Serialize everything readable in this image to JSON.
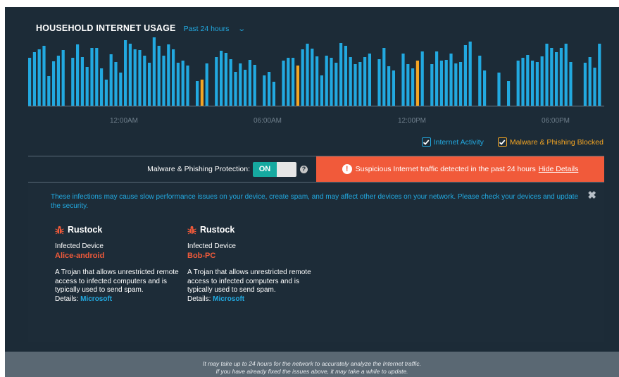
{
  "header": {
    "title": "HOUSEHOLD INTERNET USAGE",
    "range_label": "Past 24 hours"
  },
  "colors": {
    "activity": "#22a9e0",
    "malware": "#f5a623",
    "alert_bg": "#f15a3a",
    "toggle_on": "#16a9a0",
    "panel_bg": "#1c2b37"
  },
  "chart_data": {
    "type": "bar",
    "xlabel": "",
    "ylabel": "",
    "x_tick_labels": [
      "12:00AM",
      "06:00AM",
      "12:00PM",
      "06:00PM"
    ],
    "series": [
      {
        "name": "Internet Activity",
        "values": [
          68,
          76,
          80,
          85,
          42,
          63,
          71,
          79,
          0,
          68,
          87,
          69,
          55,
          82,
          82,
          53,
          37,
          73,
          62,
          47,
          93,
          88,
          80,
          79,
          71,
          61,
          97,
          85,
          71,
          87,
          80,
          61,
          64,
          57,
          0,
          35,
          0,
          60,
          0,
          69,
          78,
          75,
          66,
          48,
          60,
          51,
          65,
          58,
          0,
          43,
          48,
          34,
          0,
          64,
          68,
          68,
          0,
          80,
          88,
          81,
          70,
          43,
          71,
          68,
          61,
          89,
          85,
          69,
          59,
          62,
          69,
          74,
          0,
          66,
          82,
          56,
          50,
          0,
          74,
          59,
          53,
          0,
          77,
          0,
          59,
          77,
          64,
          65,
          74,
          60,
          62,
          86,
          91,
          0,
          71,
          50,
          0,
          0,
          47,
          0,
          35,
          0,
          64,
          68,
          72,
          64,
          62,
          70,
          88,
          82,
          76,
          82,
          88,
          62,
          0,
          0,
          61,
          69,
          54,
          88
        ]
      },
      {
        "name": "Malware & Phishing Blocked",
        "values": [
          0,
          0,
          0,
          0,
          0,
          0,
          0,
          0,
          0,
          0,
          0,
          0,
          0,
          0,
          0,
          0,
          0,
          0,
          0,
          0,
          0,
          0,
          0,
          0,
          0,
          0,
          0,
          0,
          0,
          0,
          0,
          0,
          0,
          0,
          0,
          0,
          37,
          0,
          0,
          0,
          0,
          0,
          0,
          0,
          0,
          0,
          0,
          0,
          0,
          0,
          0,
          0,
          0,
          0,
          0,
          0,
          57,
          0,
          0,
          0,
          0,
          0,
          0,
          0,
          0,
          0,
          0,
          0,
          0,
          0,
          0,
          0,
          0,
          0,
          0,
          0,
          0,
          0,
          0,
          0,
          0,
          64,
          0,
          0,
          0,
          0,
          0,
          0,
          0,
          0,
          0,
          0,
          0,
          0,
          0,
          0,
          0,
          0,
          0,
          0,
          0,
          0,
          0,
          0,
          0,
          0,
          0,
          0,
          0,
          0,
          0,
          0,
          0,
          0,
          0,
          0,
          0,
          0,
          0,
          0,
          0,
          0
        ]
      }
    ]
  },
  "legend": {
    "activity_label": "Internet Activity",
    "malware_label": "Malware & Phishing Blocked"
  },
  "protection": {
    "label": "Malware & Phishing Protection:",
    "state": "ON"
  },
  "alert": {
    "message": "Suspicious Internet traffic detected in the past 24 hours",
    "link": "Hide Details"
  },
  "details": {
    "info": "These infections may cause slow performance issues on your device, create spam, and may affect other devices on your network. Please check your devices and update the security.",
    "infections": [
      {
        "name": "Rustock",
        "device_label": "Infected Device",
        "device": "Alice-android",
        "description": "A Trojan that allows unrestricted remote access to infected computers and is typically used to send spam.",
        "details_label": "Details:",
        "details_link": "Microsoft"
      },
      {
        "name": "Rustock",
        "device_label": "Infected Device",
        "device": "Bob-PC",
        "description": "A Trojan that allows unrestricted remote access to infected computers and is typically used to send spam.",
        "details_label": "Details:",
        "details_link": "Microsoft"
      }
    ]
  },
  "footer": {
    "line1": "It may take up to 24 hours for the network to accurately analyze the Internet traffic.",
    "line2": "If you have already fixed the issues above, it may take a while to update."
  }
}
